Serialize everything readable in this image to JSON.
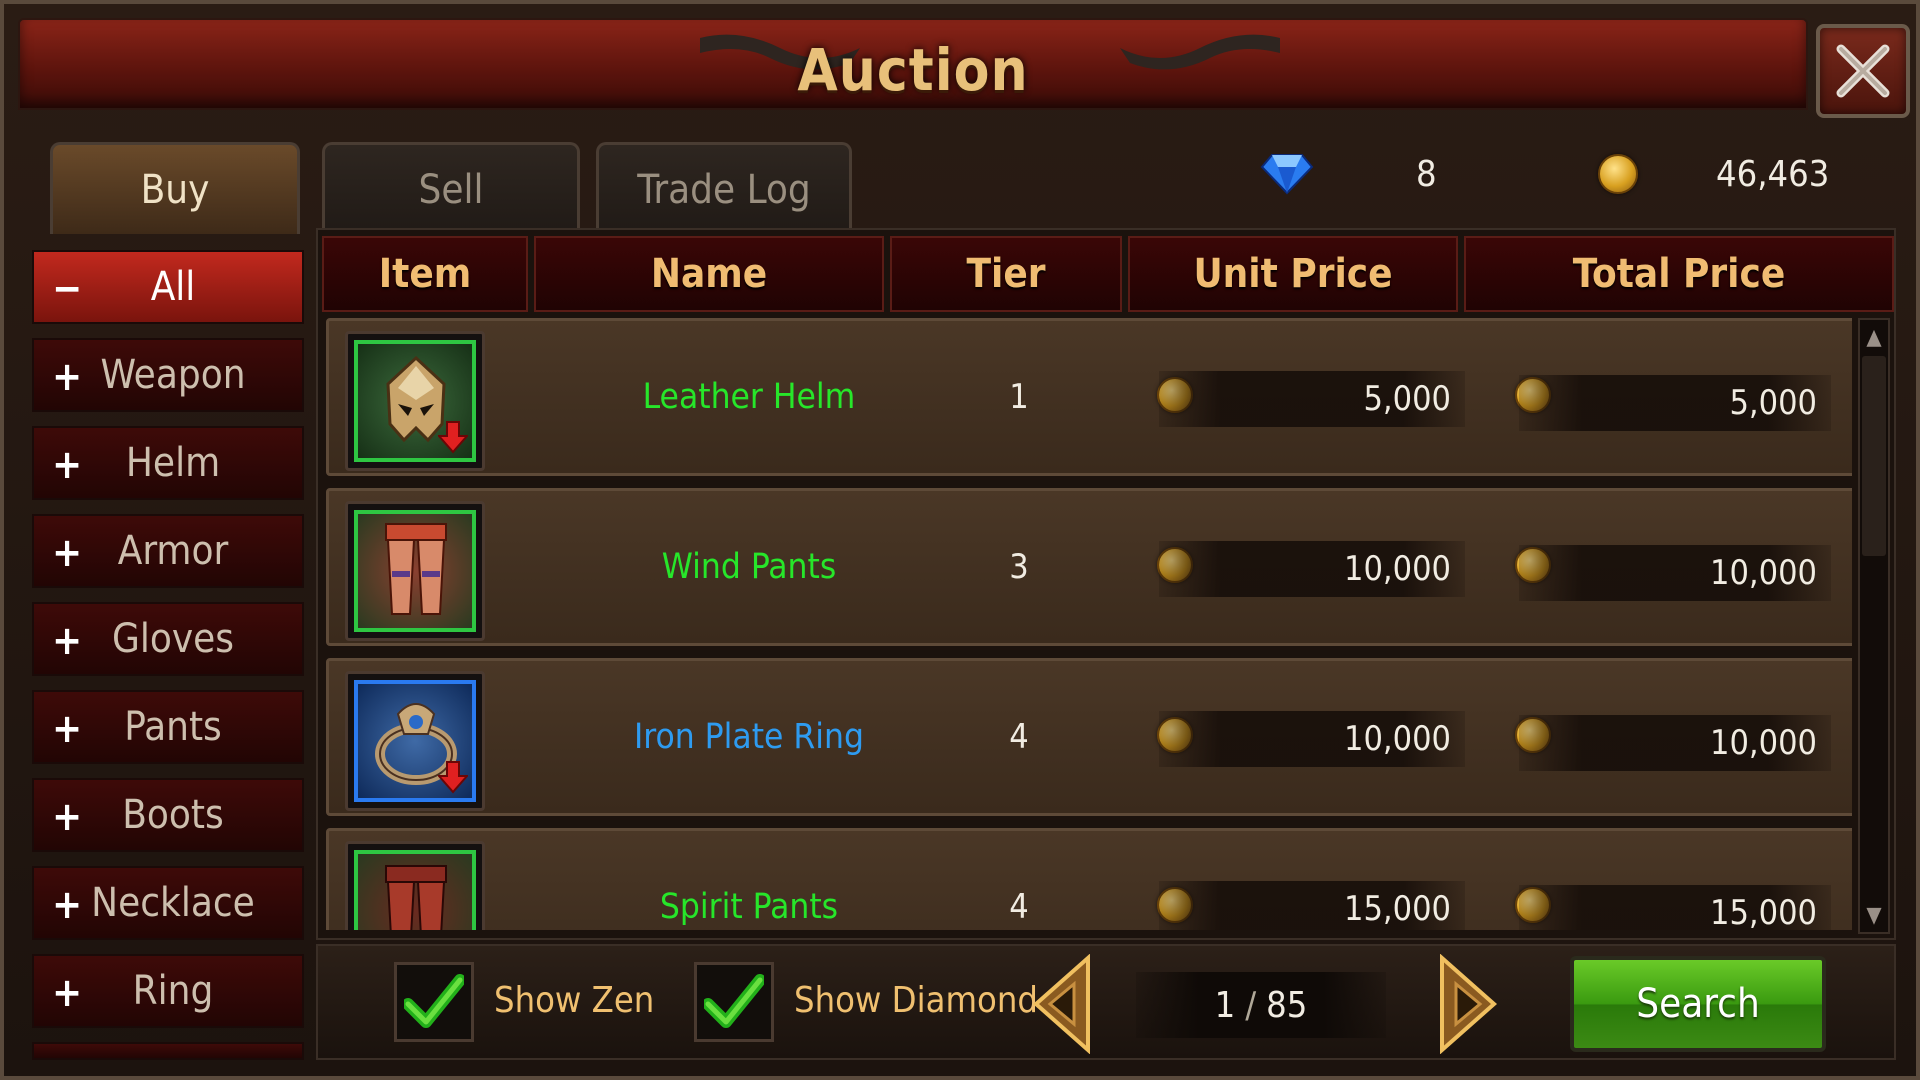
{
  "window": {
    "title": "Auction",
    "close_icon": "close-icon"
  },
  "tabs": [
    {
      "label": "Buy",
      "active": true
    },
    {
      "label": "Sell",
      "active": false
    },
    {
      "label": "Trade Log",
      "active": false
    }
  ],
  "currency": {
    "diamond": "8",
    "zen": "46,463"
  },
  "categories": [
    {
      "label": "All",
      "symbol": "−",
      "active": true
    },
    {
      "label": "Weapon",
      "symbol": "+"
    },
    {
      "label": "Helm",
      "symbol": "+"
    },
    {
      "label": "Armor",
      "symbol": "+"
    },
    {
      "label": "Gloves",
      "symbol": "+"
    },
    {
      "label": "Pants",
      "symbol": "+"
    },
    {
      "label": "Boots",
      "symbol": "+"
    },
    {
      "label": "Necklace",
      "symbol": "+"
    },
    {
      "label": "Ring",
      "symbol": "+"
    }
  ],
  "table": {
    "headers": [
      "Item",
      "Name",
      "Tier",
      "Unit Price",
      "Total Price"
    ],
    "rows": [
      {
        "icon": "helm-icon",
        "name": "Leather Helm",
        "tier": "1",
        "unit_price": "5,000",
        "total_price": "5,000",
        "rarity_color": "#27e62a",
        "frame": "green",
        "downgrade": true
      },
      {
        "icon": "pants-icon",
        "name": "Wind Pants",
        "tier": "3",
        "unit_price": "10,000",
        "total_price": "10,000",
        "rarity_color": "#27e62a",
        "frame": "green",
        "downgrade": false
      },
      {
        "icon": "ring-icon",
        "name": "Iron Plate Ring",
        "tier": "4",
        "unit_price": "10,000",
        "total_price": "10,000",
        "rarity_color": "#2e9bf0",
        "frame": "blue",
        "downgrade": true
      },
      {
        "icon": "pants-icon",
        "name": "Spirit Pants",
        "tier": "4",
        "unit_price": "15,000",
        "total_price": "15,000",
        "rarity_color": "#27e62a",
        "frame": "green",
        "downgrade": false
      }
    ]
  },
  "filters": {
    "show_zen": "Show Zen",
    "show_diamond": "Show Diamond",
    "show_zen_checked": true,
    "show_diamond_checked": true
  },
  "pagination": {
    "current": "1",
    "separator": "/",
    "total": "85"
  },
  "search_label": "Search",
  "colors": {
    "title": "#e8c07a",
    "header": "#f0bc72",
    "active_category": "#c2291e",
    "search_button": "#4aaa18"
  }
}
